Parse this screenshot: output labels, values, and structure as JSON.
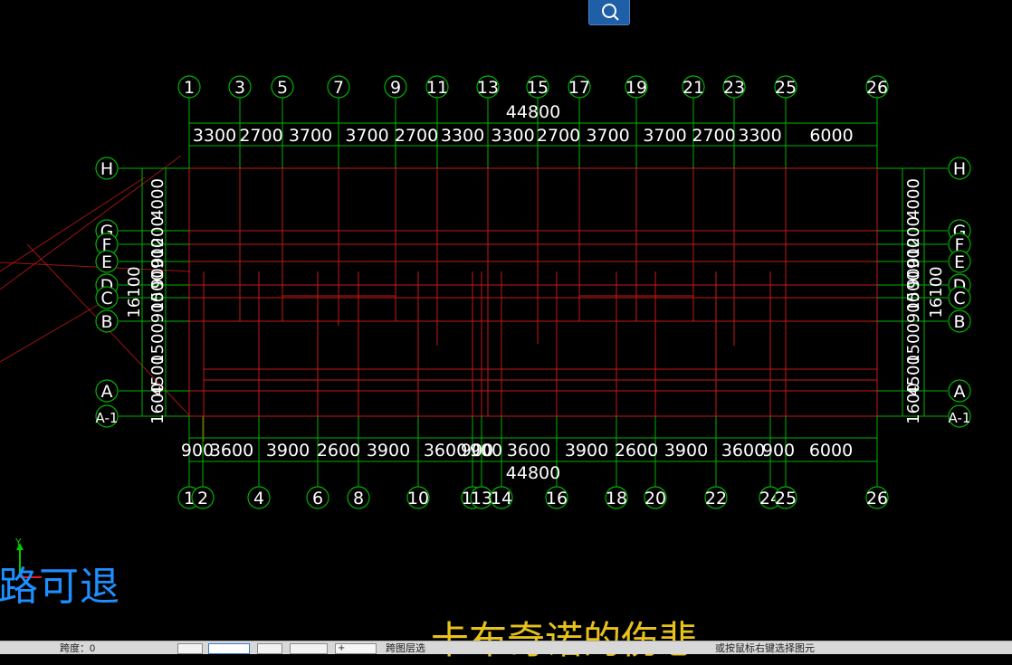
{
  "search_icon": "search-icon",
  "colors": {
    "axis": "#00b400",
    "beam": "#c81818",
    "text": "#ffffff",
    "bubble": "#00b400"
  },
  "drawing": {
    "top_axes": [
      "1",
      "3",
      "5",
      "7",
      "9",
      "11",
      "13",
      "15",
      "17",
      "19",
      "21",
      "23",
      "25",
      "26"
    ],
    "top_total": "44800",
    "top_dims": [
      "3300",
      "2700",
      "3700",
      "3700",
      "2700",
      "3300",
      "3300",
      "2700",
      "3700",
      "3700",
      "2700",
      "3300",
      "6000"
    ],
    "bottom_axes": [
      "1",
      "2",
      "4",
      "6",
      "8",
      "10",
      "12",
      "13",
      "14",
      "16",
      "18",
      "20",
      "22",
      "24",
      "25",
      "26"
    ],
    "bottom_total": "44800",
    "bottom_dims": [
      "900",
      "3600",
      "3900",
      "2600",
      "3900",
      "3600",
      "900",
      "900",
      "3600",
      "3900",
      "2600",
      "3900",
      "3600",
      "900",
      "6000"
    ],
    "row_axes": [
      "H",
      "G",
      "F",
      "E",
      "D",
      "C",
      "B",
      "A",
      "A-1"
    ],
    "row_dims": [
      "4000",
      "1200",
      "900",
      "900",
      "1500",
      "900",
      "1500",
      "4500",
      "1600"
    ],
    "row_total": "16100"
  },
  "overlay": {
    "left_text": "路可退",
    "bottom_text": "卡布奇诺的伤悲"
  },
  "statusbar": {
    "left_label": "跨度：0",
    "combo_value": "+",
    "text_1": "跨图层选",
    "text_2": "或按鼠标右键选择图元"
  },
  "ucs_label": "Y"
}
